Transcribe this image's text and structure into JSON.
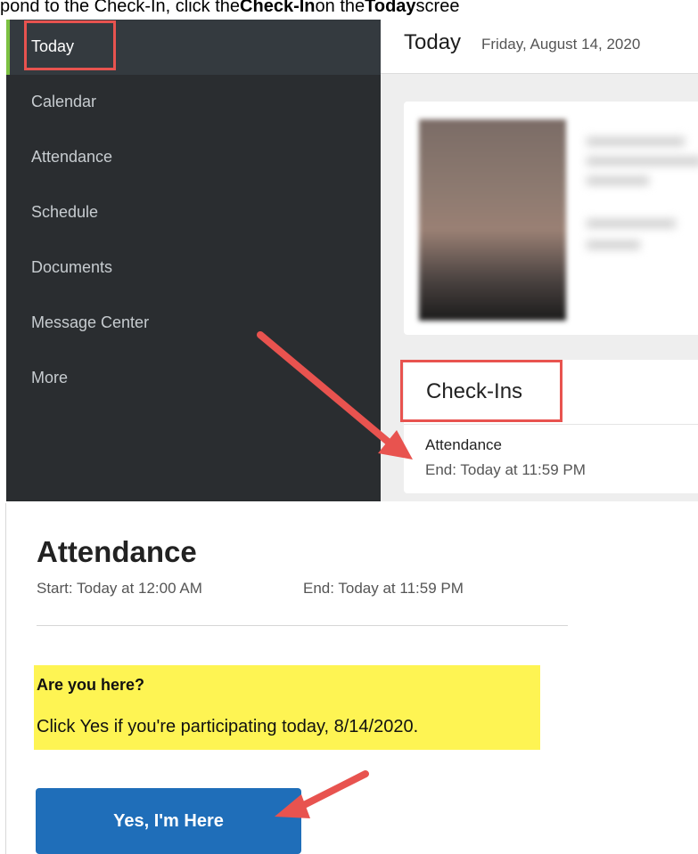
{
  "caption": {
    "prefix": "pond to the Check-In, click the ",
    "bold1": "Check-In",
    "middle": " on the ",
    "bold2": "Today",
    "suffix": " scree"
  },
  "sidebar": {
    "items": [
      {
        "label": "Today",
        "active": true
      },
      {
        "label": "Calendar"
      },
      {
        "label": "Attendance"
      },
      {
        "label": "Schedule"
      },
      {
        "label": "Documents"
      },
      {
        "label": "Message Center"
      },
      {
        "label": "More"
      }
    ]
  },
  "header": {
    "title": "Today",
    "date": "Friday, August 14, 2020"
  },
  "checkins": {
    "title": "Check-Ins",
    "item_title": "Attendance",
    "item_end": "End: Today at 11:59 PM"
  },
  "attendance": {
    "title": "Attendance",
    "start": "Start: Today at 12:00 AM",
    "end": "End: Today at 11:59 PM",
    "question": "Are you here?",
    "instruction": "Click Yes if you're participating today, 8/14/2020.",
    "button_label": "Yes, I'm Here"
  },
  "colors": {
    "highlight_red": "#e8534f",
    "active_accent": "#7cc142",
    "button_blue": "#1f6eb9",
    "highlight_yellow": "#fef453"
  }
}
